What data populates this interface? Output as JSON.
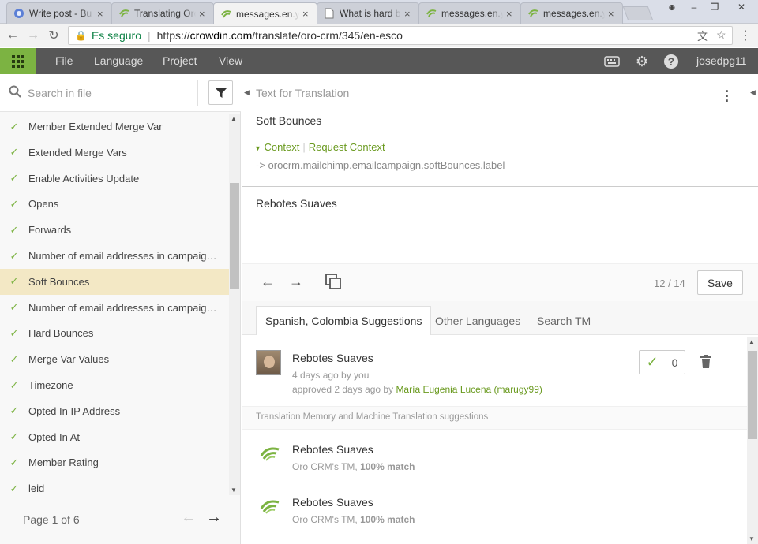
{
  "browser": {
    "tabs": [
      {
        "title": "Write post - Bu",
        "favicon": "blogger-icon"
      },
      {
        "title": "Translating Oro",
        "favicon": "crowdin-icon"
      },
      {
        "title": "messages.en.yi",
        "favicon": "crowdin-icon"
      },
      {
        "title": "What is hard b",
        "favicon": "page-icon"
      },
      {
        "title": "messages.en.yi",
        "favicon": "crowdin-icon"
      },
      {
        "title": "messages.en.yi",
        "favicon": "crowdin-icon"
      }
    ],
    "security_label": "Es seguro",
    "url_scheme": "https://",
    "url_domain": "crowdin.com",
    "url_path": "/translate/oro-crm/345/en-esco"
  },
  "menubar": {
    "items": [
      "File",
      "Language",
      "Project",
      "View"
    ],
    "username": "josedpg11"
  },
  "sidebar": {
    "search_placeholder": "Search in file",
    "strings": [
      {
        "label": "Member Extended Merge Var",
        "selected": false
      },
      {
        "label": "Extended Merge Vars",
        "selected": false
      },
      {
        "label": "Enable Activities Update",
        "selected": false
      },
      {
        "label": "Opens",
        "selected": false
      },
      {
        "label": "Forwards",
        "selected": false
      },
      {
        "label": "Number of email addresses in campaign...",
        "selected": false
      },
      {
        "label": "Soft Bounces",
        "selected": true
      },
      {
        "label": "Number of email addresses in campaign...",
        "selected": false
      },
      {
        "label": "Hard Bounces",
        "selected": false
      },
      {
        "label": "Merge Var Values",
        "selected": false
      },
      {
        "label": "Timezone",
        "selected": false
      },
      {
        "label": "Opted In IP Address",
        "selected": false
      },
      {
        "label": "Opted In At",
        "selected": false
      },
      {
        "label": "Member Rating",
        "selected": false
      },
      {
        "label": "leid",
        "selected": false
      }
    ],
    "pager_text": "Page 1 of 6"
  },
  "editor": {
    "header": "Text for Translation",
    "source_text": "Soft Bounces",
    "context_label": "Context",
    "request_context_label": "Request Context",
    "string_key": "-> orocrm.mailchimp.emailcampaign.softBounces.label",
    "translation": "Rebotes Suaves",
    "counter": "12 / 14",
    "save_label": "Save"
  },
  "suggestions": {
    "tabs": [
      "Spanish, Colombia Suggestions",
      "Other Languages",
      "Search TM"
    ],
    "user_suggestion": {
      "text": "Rebotes Suaves",
      "time": "4 days ago by you",
      "approved_prefix": "approved 2 days ago by ",
      "approver": "María Eugenia Lucena (marugy99)",
      "votes": "0"
    },
    "tm_header": "Translation Memory and Machine Translation suggestions",
    "tm_items": [
      {
        "text": "Rebotes Suaves",
        "source": "Oro CRM's TM, ",
        "match": "100% match"
      },
      {
        "text": "Rebotes Suaves",
        "source": "Oro CRM's TM, ",
        "match": "100% match"
      }
    ]
  },
  "colors": {
    "brand_green": "#7cb342",
    "menubar_bg": "#575757",
    "selected_row": "#f3e8c5"
  }
}
